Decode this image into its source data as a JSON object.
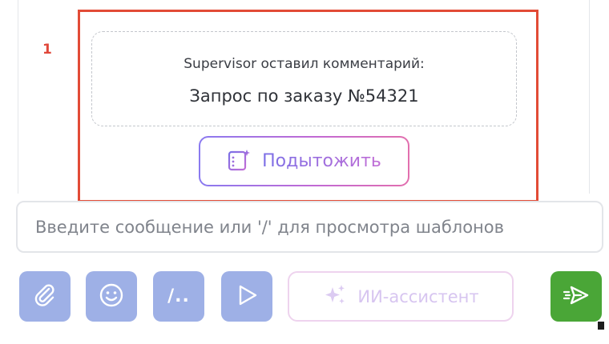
{
  "annotation": {
    "number": "1"
  },
  "comment": {
    "author_line": "Supervisor оставил комментарий:",
    "text": "Запрос по заказу №54321"
  },
  "summarize_button": {
    "label": "Подытожить",
    "icon": "summary-list-icon"
  },
  "composer": {
    "placeholder": "Введите сообщение или '/' для просмотра шаблонов",
    "value": ""
  },
  "toolbar": {
    "attach_icon": "paperclip-icon",
    "emoji_icon": "smiley-icon",
    "templates_label": "/..",
    "play_icon": "play-icon",
    "ai_label": "ИИ-ассистент",
    "ai_icon": "sparkles-icon",
    "send_icon": "send-icon"
  },
  "colors": {
    "highlight_border": "#e24b36",
    "tool_button_bg": "#9eb0e6",
    "send_button_bg": "#4aa637",
    "accent_gradient_start": "#8a7af0",
    "accent_gradient_end": "#e26fae"
  }
}
